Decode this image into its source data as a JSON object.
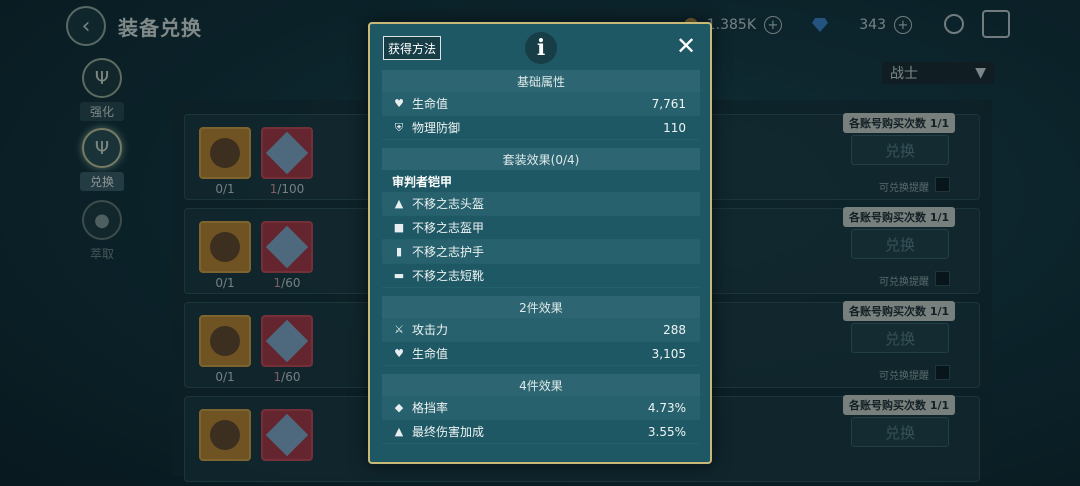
{
  "header": {
    "title": "装备兑换",
    "coins": "1.385K",
    "gems": "343"
  },
  "nav": [
    {
      "label": "强化"
    },
    {
      "label": "兑换"
    },
    {
      "label": "萃取"
    }
  ],
  "class_select": {
    "value": "战士"
  },
  "rows": [
    {
      "gear_count": "0/1",
      "mat_have": "1",
      "mat_need": "/100",
      "limit": "各账号购买次数 1/1",
      "button": "兑换",
      "remind": "可兑换提醒"
    },
    {
      "gear_count": "0/1",
      "mat_have": "1",
      "mat_need": "/60",
      "limit": "各账号购买次数 1/1",
      "button": "兑换",
      "remind": "可兑换提醒"
    },
    {
      "gear_count": "0/1",
      "mat_have": "1",
      "mat_need": "/60",
      "limit": "各账号购买次数 1/1",
      "button": "兑换",
      "remind": "可兑换提醒"
    },
    {
      "gear_count": "",
      "mat_have": "",
      "mat_need": "",
      "limit": "各账号购买次数 1/1",
      "button": "兑换",
      "remind": ""
    }
  ],
  "modal": {
    "obtain_label": "获得方法",
    "info_glyph": "i",
    "close_glyph": "✕",
    "basic": {
      "title": "基础属性",
      "stats": [
        {
          "label": "生命值",
          "value": "7,761",
          "icon": "heart-icon"
        },
        {
          "label": "物理防御",
          "value": "110",
          "icon": "shield-icon"
        }
      ]
    },
    "set": {
      "title": "套装效果(0/4)",
      "name": "审判者铠甲",
      "pieces": [
        {
          "label": "不移之志头盔"
        },
        {
          "label": "不移之志盔甲"
        },
        {
          "label": "不移之志护手"
        },
        {
          "label": "不移之志短靴"
        }
      ]
    },
    "two_piece": {
      "title": "2件效果",
      "stats": [
        {
          "label": "攻击力",
          "value": "288"
        },
        {
          "label": "生命值",
          "value": "3,105"
        }
      ]
    },
    "four_piece": {
      "title": "4件效果",
      "stats": [
        {
          "label": "格挡率",
          "value": "4.73%"
        },
        {
          "label": "最终伤害加成",
          "value": "3.55%"
        }
      ]
    }
  }
}
